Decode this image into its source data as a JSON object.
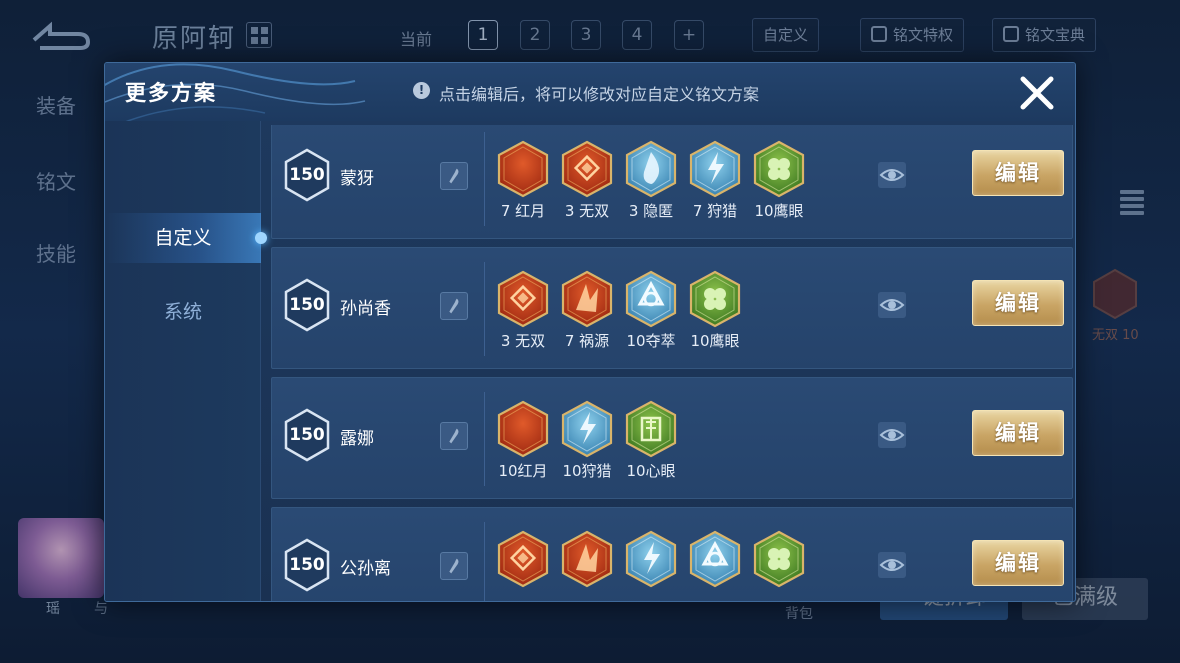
{
  "background": {
    "hero_name": "原阿轲",
    "current_label": "当前",
    "page_tabs": [
      "1",
      "2",
      "3",
      "4",
      "+"
    ],
    "custom_button": "自定义",
    "rune_privilege_button": "铭文特权",
    "rune_codex_button": "铭文宝典",
    "side_nav": [
      "装备",
      "铭文",
      "技能"
    ],
    "right_rune_label": "无双 10",
    "portrait_label": "瑶",
    "portrait_label2": "与",
    "bag_label": "背包",
    "bottom_buttons": [
      "一键拆卸",
      "已满级"
    ]
  },
  "modal": {
    "title": "更多方案",
    "hint": "点击编辑后，将可以修改对应自定义铭文方案",
    "tabs": [
      {
        "label": "自定义",
        "active": true
      },
      {
        "label": "系统",
        "active": false
      }
    ],
    "edit_label": "编辑",
    "plans": [
      {
        "level": "150",
        "name": "蒙犽",
        "runes": [
          {
            "name": "红月",
            "count": "7",
            "label": "7 红月",
            "color": "red",
            "icon": "moon-icon"
          },
          {
            "name": "无双",
            "count": "3",
            "label": "3 无双",
            "color": "red",
            "icon": "diamond-icon"
          },
          {
            "name": "隐匿",
            "count": "3",
            "label": "3 隐匿",
            "color": "blue",
            "icon": "flame-icon"
          },
          {
            "name": "狩猎",
            "count": "7",
            "label": "7 狩猎",
            "color": "blue",
            "icon": "lightning-icon"
          },
          {
            "name": "鹰眼",
            "count": "10",
            "label": "10鹰眼",
            "color": "green",
            "icon": "clover-icon"
          }
        ]
      },
      {
        "level": "150",
        "name": "孙尚香",
        "runes": [
          {
            "name": "无双",
            "count": "3",
            "label": "3 无双",
            "color": "red",
            "icon": "diamond-icon"
          },
          {
            "name": "祸源",
            "count": "7",
            "label": "7 祸源",
            "color": "red",
            "icon": "shard-icon"
          },
          {
            "name": "夺萃",
            "count": "10",
            "label": "10夺萃",
            "color": "blue",
            "icon": "knot-icon"
          },
          {
            "name": "鹰眼",
            "count": "10",
            "label": "10鹰眼",
            "color": "green",
            "icon": "clover-icon"
          }
        ]
      },
      {
        "level": "150",
        "name": "露娜",
        "runes": [
          {
            "name": "红月",
            "count": "10",
            "label": "10红月",
            "color": "red",
            "icon": "moon-icon"
          },
          {
            "name": "狩猎",
            "count": "10",
            "label": "10狩猎",
            "color": "blue",
            "icon": "lightning-icon"
          },
          {
            "name": "心眼",
            "count": "10",
            "label": "10心眼",
            "color": "green",
            "icon": "gate-icon"
          }
        ]
      },
      {
        "level": "150",
        "name": "公孙离",
        "runes": [
          {
            "name": "无双",
            "count": "",
            "label": "",
            "color": "red",
            "icon": "diamond-icon"
          },
          {
            "name": "祸源",
            "count": "",
            "label": "",
            "color": "red",
            "icon": "shard-icon"
          },
          {
            "name": "狩猎",
            "count": "",
            "label": "",
            "color": "blue",
            "icon": "lightning-icon"
          },
          {
            "name": "夺萃",
            "count": "",
            "label": "",
            "color": "blue",
            "icon": "knot-icon"
          },
          {
            "name": "鹰眼",
            "count": "",
            "label": "",
            "color": "green",
            "icon": "clover-icon"
          }
        ]
      }
    ]
  },
  "colors": {
    "red_rune": "#c8451f",
    "blue_rune": "#6fb6d6",
    "green_rune": "#6ea43a",
    "edit_gold": "#c9a565",
    "active_tab": "#4aa6ff"
  }
}
